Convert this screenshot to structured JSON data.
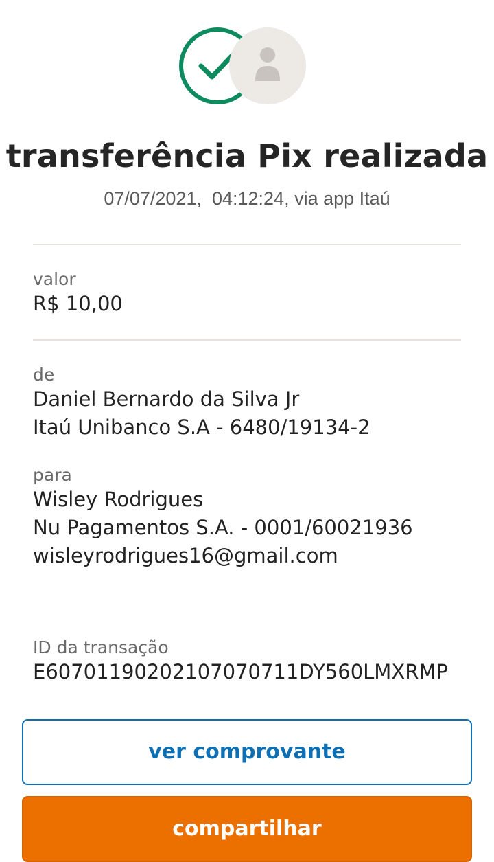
{
  "header": {
    "title": "transferência Pix realizada",
    "subtitle": "07/07/2021,  04:12:24, via app Itaú",
    "status_icon": "check-circle-icon",
    "avatar_icon": "person-icon"
  },
  "amount": {
    "label": "valor",
    "value": "R$ 10,00"
  },
  "from": {
    "label": "de",
    "name": "Daniel Bernardo da Silva Jr",
    "bank": "Itaú Unibanco S.A - 6480/19134-2"
  },
  "to": {
    "label": "para",
    "name": "Wisley Rodrigues",
    "bank": "Nu Pagamentos S.A. - 0001/60021936",
    "key": "wisleyrodrigues16@gmail.com"
  },
  "transaction": {
    "label": "ID da transação",
    "id": "E60701190202107070711DY560LMXRMP"
  },
  "actions": {
    "view_receipt": "ver comprovante",
    "share": "compartilhar"
  },
  "colors": {
    "success": "#0e8a5f",
    "link": "#0f6fb3",
    "primary": "#ec7000"
  }
}
